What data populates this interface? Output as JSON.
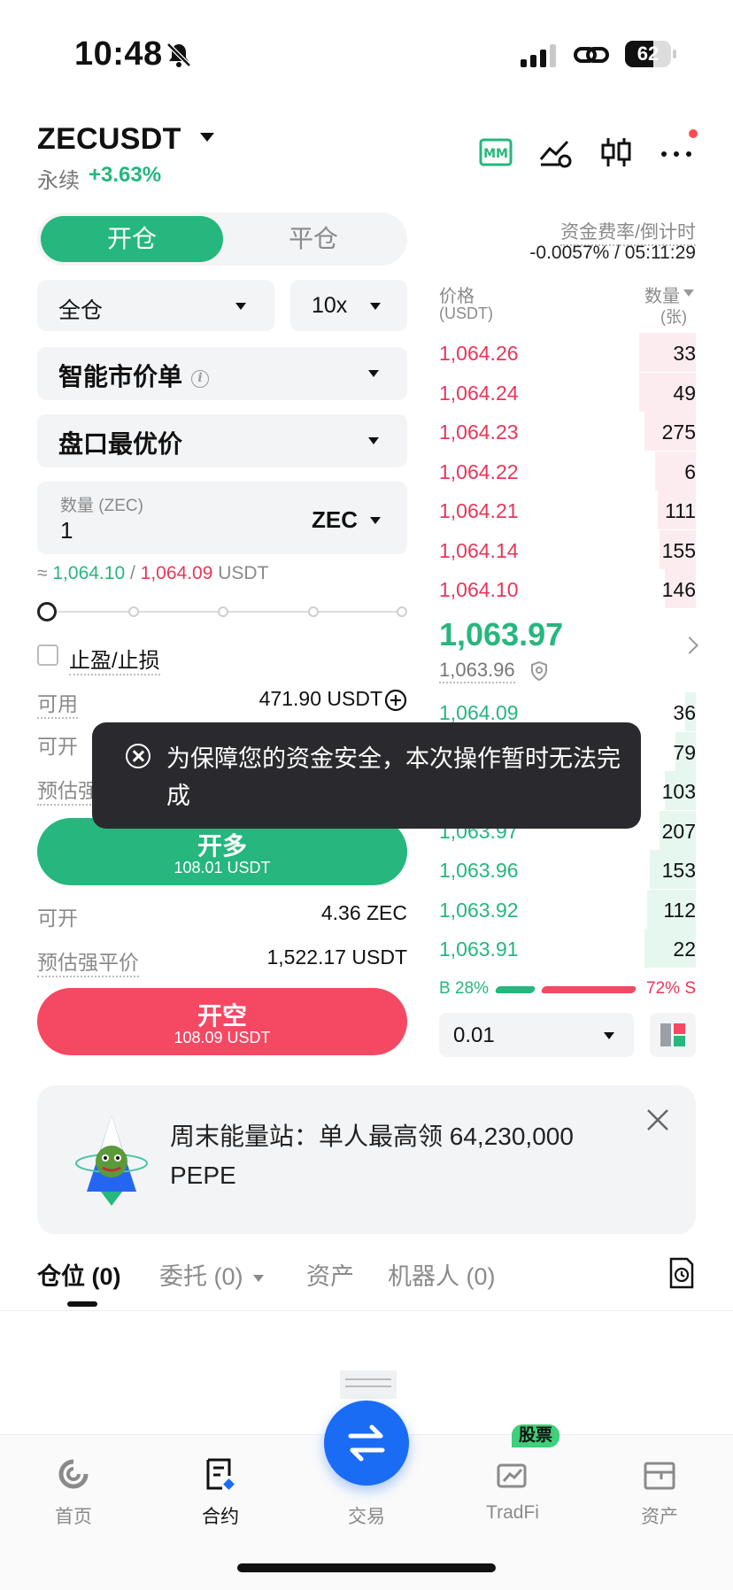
{
  "status_bar": {
    "time": "10:48",
    "battery": "62",
    "battery_level": 0.62
  },
  "header": {
    "pair": "ZECUSDT",
    "contract_type": "永续",
    "change": "+3.63%",
    "icons": [
      "mm-icon",
      "chart-settings-icon",
      "candlestick-icon",
      "more-icon"
    ]
  },
  "order_form": {
    "tab_open": "开仓",
    "tab_close": "平仓",
    "margin_mode": "全仓",
    "leverage": "10x",
    "order_type": "智能市价单",
    "price_type": "盘口最优价",
    "quantity_label": "数量 (ZEC)",
    "quantity_value": "1",
    "quantity_unit": "ZEC",
    "approx_prefix": "≈",
    "approx_buy": "1,064.10",
    "approx_sep": "/",
    "approx_sell": "1,064.09",
    "approx_unit": "USDT",
    "tp_sl_label": "止盈/止损",
    "available_label": "可用",
    "available_value": "471.90 USDT",
    "long_can_open_label": "可开",
    "long_liq_label": "预估强",
    "long_button": "开多",
    "long_button_sub": "108.01 USDT",
    "short_can_open_label": "可开",
    "short_can_open_value": "4.36 ZEC",
    "short_liq_label": "预估强平价",
    "short_liq_value": "1,522.17 USDT",
    "short_button": "开空",
    "short_button_sub": "108.09 USDT"
  },
  "funding": {
    "label": "资金费率/倒计时",
    "value": "-0.0057% / 05:11:29"
  },
  "order_book": {
    "price_header": "价格",
    "price_unit": "(USDT)",
    "qty_header": "数量",
    "qty_unit": "(张)",
    "asks": [
      {
        "price": "1,064.26",
        "qty": "33",
        "depth": 0.22
      },
      {
        "price": "1,064.24",
        "qty": "49",
        "depth": 0.22
      },
      {
        "price": "1,064.23",
        "qty": "275",
        "depth": 0.2
      },
      {
        "price": "1,064.22",
        "qty": "6",
        "depth": 0.16
      },
      {
        "price": "1,064.21",
        "qty": "111",
        "depth": 0.15
      },
      {
        "price": "1,064.14",
        "qty": "155",
        "depth": 0.14
      },
      {
        "price": "1,064.10",
        "qty": "146",
        "depth": 0.12
      }
    ],
    "last_price": "1,063.97",
    "mark_price": "1,063.96",
    "bids": [
      {
        "price": "1,064.09",
        "qty": "36",
        "depth": 0.04
      },
      {
        "price": "",
        "qty": "79",
        "depth": 0.08
      },
      {
        "price": "",
        "qty": "103",
        "depth": 0.12
      },
      {
        "price": "1,063.97",
        "qty": "207",
        "depth": 0.14
      },
      {
        "price": "1,063.96",
        "qty": "153",
        "depth": 0.18
      },
      {
        "price": "1,063.92",
        "qty": "112",
        "depth": 0.19
      },
      {
        "price": "1,063.91",
        "qty": "22",
        "depth": 0.2
      }
    ],
    "buy_ratio": "B 28%",
    "sell_ratio": "72% S",
    "depth_step": "0.01"
  },
  "banner": {
    "text": "周末能量站：单人最高领 64,230,000 PEPE"
  },
  "tabs": [
    {
      "label": "仓位 (0)"
    },
    {
      "label": "委托 (0)"
    },
    {
      "label": "资产"
    },
    {
      "label": "机器人 (0)"
    }
  ],
  "bottom_nav": [
    {
      "label": "首页"
    },
    {
      "label": "合约"
    },
    {
      "label": "交易"
    },
    {
      "label": "TradFi",
      "badge": "股票"
    },
    {
      "label": "资产"
    }
  ],
  "toast": {
    "message": "为保障您的资金安全，本次操作暂时无法完成"
  },
  "colors": {
    "green": "#25b77d",
    "red": "#e8365a",
    "accent": "#1a6cf5"
  }
}
